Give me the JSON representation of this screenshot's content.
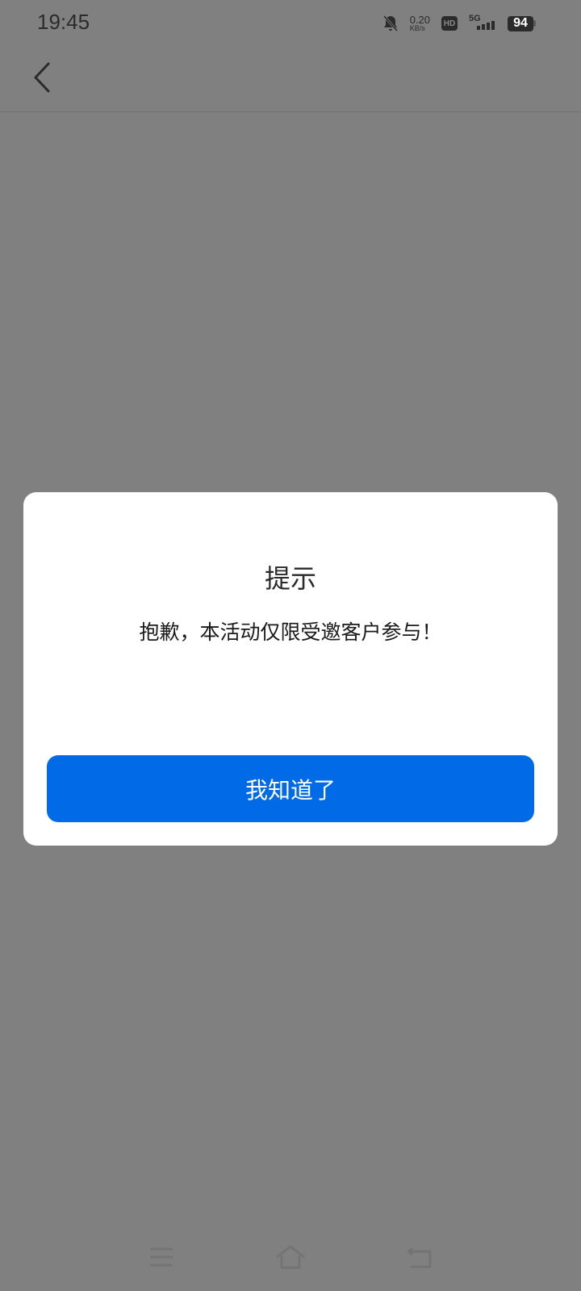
{
  "status_bar": {
    "time": "19:45",
    "net_speed_value": "0.20",
    "net_speed_unit": "KB/s",
    "hd_label": "HD",
    "network_label": "5G",
    "battery_level": "94",
    "icons": [
      "bell-muted-icon",
      "hd-icon",
      "signal-icon",
      "battery-icon"
    ]
  },
  "header": {
    "back_icon": "chevron-left-icon"
  },
  "dialog": {
    "title": "提示",
    "message": "抱歉，本活动仅限受邀客户参与！",
    "confirm_label": "我知道了",
    "button_color": "#006ae7"
  },
  "nav_bar": {
    "icons": [
      "menu-icon",
      "home-icon",
      "back-icon"
    ]
  },
  "colors": {
    "overlay": "#808080",
    "dialog_bg": "#ffffff",
    "accent": "#006ae7"
  }
}
